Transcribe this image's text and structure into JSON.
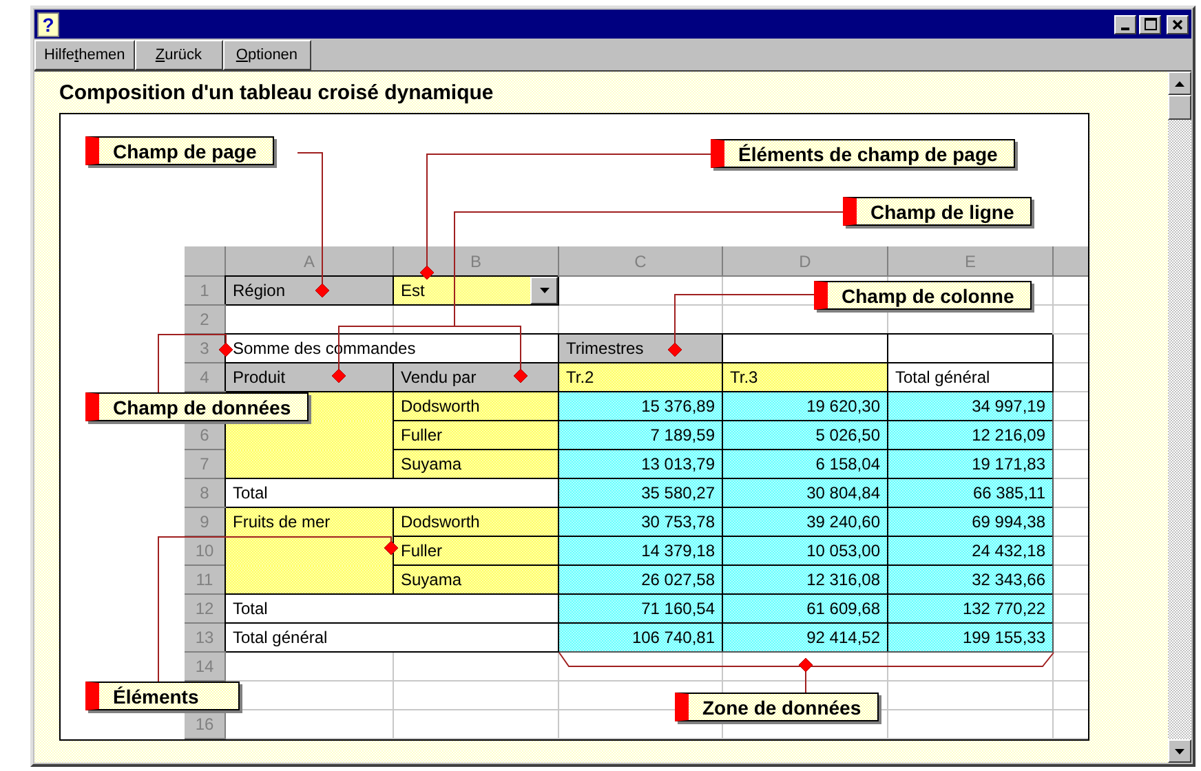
{
  "window": {
    "help_glyph": "?"
  },
  "toolbar": [
    {
      "before": "Hilfe",
      "mnemonic": "t",
      "after": "hemen"
    },
    {
      "mnemonic": "Z",
      "after": "urück"
    },
    {
      "mnemonic": "O",
      "after": "ptionen"
    }
  ],
  "heading": "Composition d'un tableau croisé dynamique",
  "sheet": {
    "columns": [
      "A",
      "B",
      "C",
      "D",
      "E"
    ],
    "rows": [
      {
        "number": "1",
        "cells": [
          {
            "kind": "field",
            "text": "Région"
          },
          {
            "kind": "dropdown",
            "text": "Est"
          }
        ]
      },
      {
        "number": "2",
        "cells": []
      },
      {
        "number": "3",
        "cells": [
          {
            "kind": "label",
            "text": "Somme des commandes",
            "wide": true
          },
          {
            "kind": "field",
            "text": "Trimestres"
          },
          {
            "kind": "label"
          },
          {
            "kind": "label"
          }
        ]
      },
      {
        "number": "4",
        "cells": [
          {
            "kind": "field",
            "text": "Produit"
          },
          {
            "kind": "field",
            "text": "Vendu par"
          },
          {
            "kind": "item",
            "text": "Tr.2"
          },
          {
            "kind": "item",
            "text": "Tr.3"
          },
          {
            "kind": "label",
            "text": "Total général"
          }
        ]
      },
      {
        "cells": [
          {
            "kind": "group"
          },
          {
            "kind": "item",
            "text": "Dodsworth"
          },
          {
            "kind": "data",
            "text": "15 376,89"
          },
          {
            "kind": "data",
            "text": "19 620,30"
          },
          {
            "kind": "data",
            "text": "34 997,19"
          }
        ]
      },
      {
        "number": "6",
        "cells": [
          {
            "kind": "group"
          },
          {
            "kind": "item",
            "text": "Fuller"
          },
          {
            "kind": "data",
            "text": "7 189,59"
          },
          {
            "kind": "data",
            "text": "5 026,50"
          },
          {
            "kind": "data",
            "text": "12 216,09"
          }
        ]
      },
      {
        "number": "7",
        "cells": [
          {
            "kind": "group"
          },
          {
            "kind": "item",
            "text": "Suyama"
          },
          {
            "kind": "data",
            "text": "13 013,79"
          },
          {
            "kind": "data",
            "text": "6 158,04"
          },
          {
            "kind": "data",
            "text": "19 171,83"
          }
        ]
      },
      {
        "number": "8",
        "cells": [
          {
            "kind": "label",
            "text": "Total",
            "wide": true
          },
          {
            "kind": "data",
            "text": "35 580,27"
          },
          {
            "kind": "data",
            "text": "30 804,84"
          },
          {
            "kind": "data",
            "text": "66 385,11"
          }
        ]
      },
      {
        "number": "9",
        "cells": [
          {
            "kind": "group",
            "text": "Fruits de mer"
          },
          {
            "kind": "item",
            "text": "Dodsworth"
          },
          {
            "kind": "data",
            "text": "30 753,78"
          },
          {
            "kind": "data",
            "text": "39 240,60"
          },
          {
            "kind": "data",
            "text": "69 994,38"
          }
        ]
      },
      {
        "number": "10",
        "cells": [
          {
            "kind": "group"
          },
          {
            "kind": "item",
            "text": "Fuller"
          },
          {
            "kind": "data",
            "text": "14 379,18"
          },
          {
            "kind": "data",
            "text": "10 053,00"
          },
          {
            "kind": "data",
            "text": "24 432,18"
          }
        ]
      },
      {
        "number": "11",
        "cells": [
          {
            "kind": "group"
          },
          {
            "kind": "item",
            "text": "Suyama"
          },
          {
            "kind": "data",
            "text": "26 027,58"
          },
          {
            "kind": "data",
            "text": "12 316,08"
          },
          {
            "kind": "data",
            "text": "32 343,66"
          }
        ]
      },
      {
        "number": "12",
        "cells": [
          {
            "kind": "label",
            "text": "Total",
            "wide": true
          },
          {
            "kind": "data",
            "text": "71 160,54"
          },
          {
            "kind": "data",
            "text": "61 609,68"
          },
          {
            "kind": "data",
            "text": "132 770,22"
          }
        ]
      },
      {
        "number": "13",
        "cells": [
          {
            "kind": "label",
            "text": "Total général",
            "wide": true
          },
          {
            "kind": "data",
            "text": "106 740,81"
          },
          {
            "kind": "data",
            "text": "92 414,52"
          },
          {
            "kind": "data",
            "text": "199 155,33"
          }
        ]
      },
      {
        "number": "14",
        "cells": []
      },
      {
        "cells": []
      },
      {
        "number": "16",
        "cells": []
      }
    ]
  },
  "callouts": [
    {
      "label": "Champ de page"
    },
    {
      "label": "Éléments de champ de page"
    },
    {
      "label": "Champ de ligne"
    },
    {
      "label": "Champ de colonne"
    },
    {
      "label": "Champ de données"
    },
    {
      "label": "Éléments"
    },
    {
      "label": "Zone de données"
    }
  ]
}
